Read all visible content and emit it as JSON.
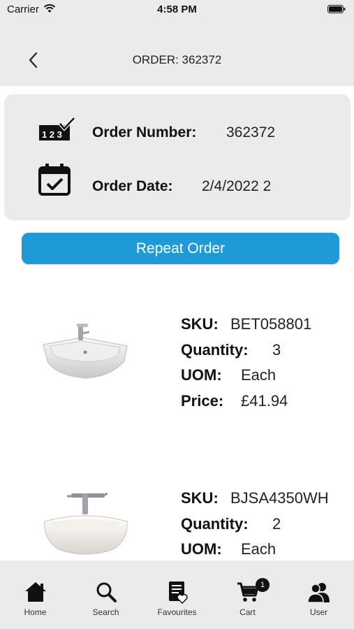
{
  "status_bar": {
    "carrier": "Carrier",
    "time": "4:58 PM"
  },
  "nav": {
    "title": "ORDER: 362372"
  },
  "order_info": {
    "number_label": "Order Number:",
    "number_value": "362372",
    "date_label": "Order Date:",
    "date_value": "2/4/2022 2"
  },
  "repeat_button": {
    "label": "Repeat Order"
  },
  "items": [
    {
      "sku_label": "SKU:",
      "sku": "BET058801",
      "qty_label": "Quantity:",
      "qty": "3",
      "uom_label": "UOM:",
      "uom": "Each",
      "price_label": "Price:",
      "price": "£41.94"
    },
    {
      "sku_label": "SKU:",
      "sku": "BJSA4350WH",
      "qty_label": "Quantity:",
      "qty": "2",
      "uom_label": "UOM:",
      "uom": "Each"
    }
  ],
  "tabs": [
    {
      "label": "Home",
      "icon": "home-icon"
    },
    {
      "label": "Search",
      "icon": "search-icon"
    },
    {
      "label": "Favourites",
      "icon": "favourites-icon"
    },
    {
      "label": "Cart",
      "icon": "cart-icon",
      "badge": "1"
    },
    {
      "label": "User",
      "icon": "user-icon"
    }
  ],
  "colors": {
    "accent": "#1e9bd7",
    "bar_bg": "#ebebeb"
  }
}
